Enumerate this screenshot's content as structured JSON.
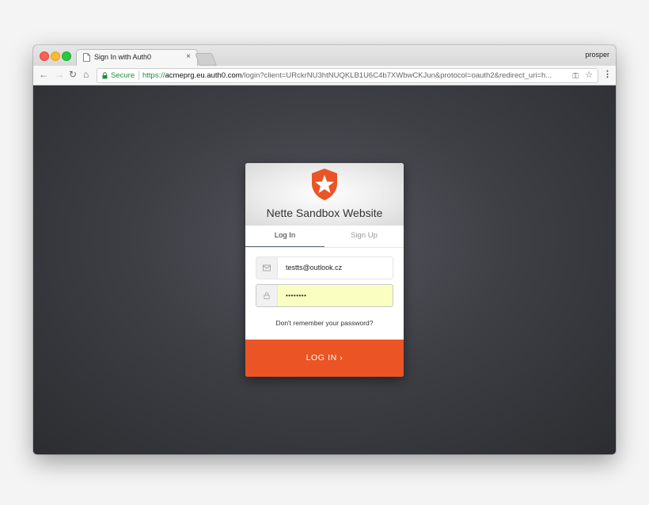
{
  "browser": {
    "tab_title": "Sign In with Auth0",
    "tab_close": "×",
    "profile_name": "prosper",
    "secure_label": "Secure",
    "url_scheme": "https://",
    "url_host": "acmeprg.eu.auth0.com",
    "url_path": "/login?client=URckrNU3htNUQKLB1U6C4b7XWbwCKJun&protocol=oauth2&redirect_uri=h...",
    "nav_icons": [
      "back-icon",
      "forward-icon",
      "reload-icon",
      "home-icon",
      "key-icon",
      "star-icon",
      "menu-icon"
    ]
  },
  "login": {
    "site_title": "Nette Sandbox Website",
    "tabs": [
      {
        "label": "Log In",
        "active": true
      },
      {
        "label": "Sign Up",
        "active": false
      }
    ],
    "email_value": "testts@outlook.cz",
    "password_value": "••••••••",
    "forgot_link": "Don't remember your password?",
    "submit_label": "LOG IN ›"
  },
  "colors": {
    "accent": "#eb5424",
    "secure_green": "#1e8e3e",
    "autofill_yellow": "#fafec0"
  }
}
